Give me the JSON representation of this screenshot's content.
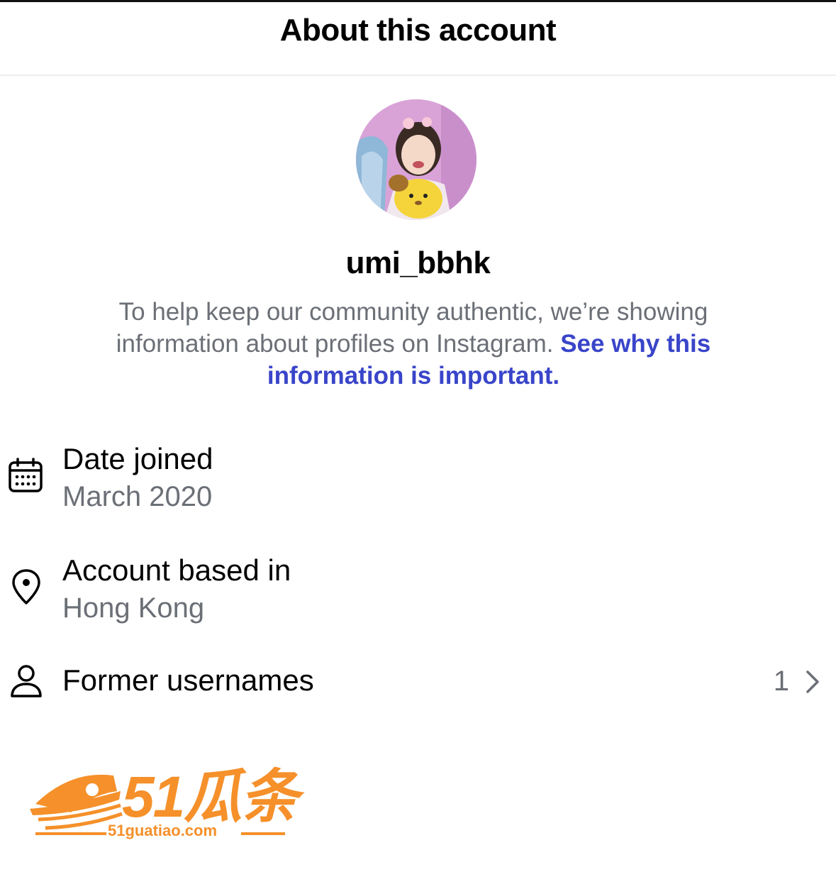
{
  "header": {
    "title": "About this account"
  },
  "profile": {
    "avatar_icon": "profile-photo",
    "username": "umi_bbhk",
    "description_text": "To help keep our community authentic, we’re showing information about profiles on Instagram. ",
    "description_link": "See why this information is important."
  },
  "rows": {
    "date_joined": {
      "icon": "calendar-icon",
      "label": "Date joined",
      "value": "March 2020"
    },
    "based_in": {
      "icon": "location-pin-icon",
      "label": "Account based in",
      "value": "Hong Kong"
    },
    "former_usernames": {
      "icon": "person-icon",
      "label": "Former usernames",
      "count": "1"
    }
  },
  "watermark": {
    "brand": "51瓜条",
    "url": "51guatiao.com"
  },
  "colors": {
    "link": "#3945c9",
    "secondary_text": "#6b6f76",
    "watermark": "#f5902a"
  }
}
